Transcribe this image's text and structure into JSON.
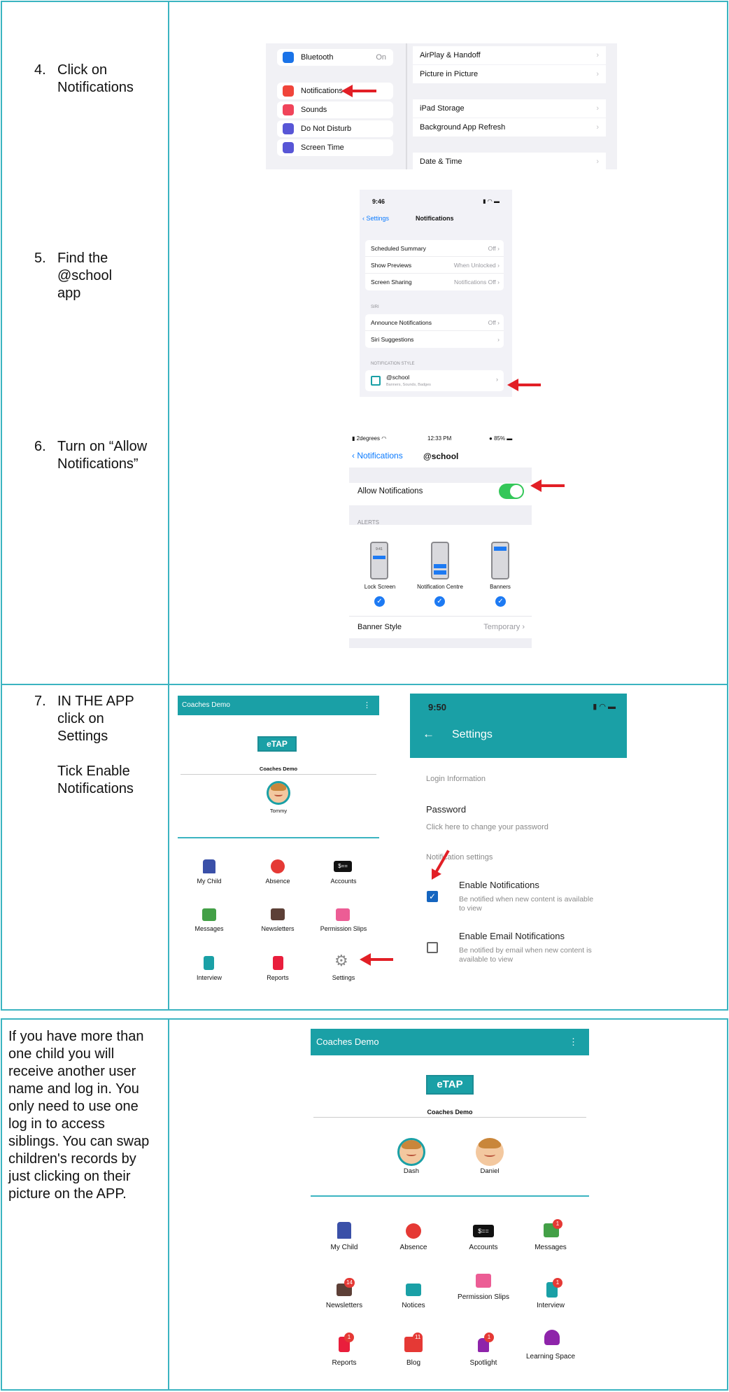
{
  "steps": [
    {
      "number": "4.",
      "lines": [
        "Click on",
        "Notifications"
      ]
    },
    {
      "number": "5.",
      "lines": [
        "Find the",
        "@school app"
      ]
    },
    {
      "number": "6.",
      "lines": [
        "Turn on “Allow",
        "Notifications”"
      ]
    },
    {
      "number": "7.",
      "lines": [
        "IN THE APP",
        "click on",
        "Settings"
      ],
      "extra_lines": [
        "Tick Enable",
        "Notifications"
      ]
    }
  ],
  "siblings_paragraph": [
    "If you have more than",
    "one child you will",
    "receive another user",
    "name and log in. You",
    "only need to use one",
    "log in to access",
    "siblings. You can swap",
    "children's records by",
    "just clicking on their",
    "picture on the APP."
  ],
  "ipad_settings": {
    "left_items": [
      {
        "label": "Bluetooth",
        "value": "On",
        "icon": "bluetooth-icon",
        "color": "#1a73e8"
      },
      {
        "label": "Notifications",
        "value": "",
        "icon": "notifications-icon",
        "color": "#f0443a"
      },
      {
        "label": "Sounds",
        "value": "",
        "icon": "sounds-icon",
        "color": "#f0445a"
      },
      {
        "label": "Do Not Disturb",
        "value": "",
        "icon": "moon-icon",
        "color": "#5856d6"
      },
      {
        "label": "Screen Time",
        "value": "",
        "icon": "hourglass-icon",
        "color": "#5856d6"
      }
    ],
    "right_items": [
      "AirPlay & Handoff",
      "Picture in Picture",
      "iPad Storage",
      "Background App Refresh",
      "Date & Time"
    ]
  },
  "phone_notifications": {
    "time": "9:46",
    "back": "Settings",
    "title": "Notifications",
    "group1": [
      {
        "label": "Scheduled Summary",
        "value": "Off"
      },
      {
        "label": "Show Previews",
        "value": "When Unlocked"
      },
      {
        "label": "Screen Sharing",
        "value": "Notifications Off"
      }
    ],
    "siri_caption": "SIRI",
    "group2": [
      {
        "label": "Announce Notifications",
        "value": "Off"
      },
      {
        "label": "Siri Suggestions",
        "value": ""
      }
    ],
    "style_caption": "NOTIFICATION STYLE",
    "app_name": "@school",
    "app_sub": "Banners, Sounds, Badges"
  },
  "phone_school": {
    "carrier": "2degrees",
    "time": "12:33 PM",
    "battery": "85%",
    "back": "Notifications",
    "title": "@school",
    "allow_label": "Allow Notifications",
    "allow_on": true,
    "alerts_caption": "ALERTS",
    "alert_types": [
      "Lock Screen",
      "Notification Centre",
      "Banners"
    ],
    "lock_time": "9:41",
    "banner_style_label": "Banner Style",
    "banner_style_value": "Temporary"
  },
  "app_home_1": {
    "bar_title": "Coaches Demo",
    "menu_glyph": "⋮",
    "logo": "eTAP",
    "school": "Coaches Demo",
    "child": "Tommy",
    "tiles": [
      "My Child",
      "Absence",
      "Accounts",
      "Messages",
      "Newsletters",
      "Permission Slips",
      "Interview",
      "Reports",
      "Settings"
    ]
  },
  "app_settings": {
    "time": "9:50",
    "title": "Settings",
    "login_section": "Login Information",
    "password_label": "Password",
    "password_hint": "Click here to change your password",
    "notif_section": "Notification settings",
    "enable_label": "Enable Notifications",
    "enable_desc": [
      "Be notified when new content is available",
      "to view"
    ],
    "enable_checked": true,
    "email_label": "Enable Email Notifications",
    "email_desc": [
      "Be notified by email when new content is",
      "available to view"
    ],
    "email_checked": false
  },
  "app_home_2": {
    "bar_title": "Coaches Demo",
    "menu_glyph": "⋮",
    "logo": "eTAP",
    "school": "Coaches Demo",
    "children": [
      "Dash",
      "Daniel"
    ],
    "tiles": [
      {
        "label": "My Child",
        "badge": ""
      },
      {
        "label": "Absence",
        "badge": ""
      },
      {
        "label": "Accounts",
        "badge": ""
      },
      {
        "label": "Messages",
        "badge": "1"
      },
      {
        "label": "Newsletters",
        "badge": "14"
      },
      {
        "label": "Notices",
        "badge": ""
      },
      {
        "label": "Permission Slips",
        "badge": ""
      },
      {
        "label": "Interview",
        "badge": "1"
      },
      {
        "label": "Reports",
        "badge": "1"
      },
      {
        "label": "Blog",
        "badge": "11"
      },
      {
        "label": "Spotlight",
        "badge": "1"
      },
      {
        "label": "Learning Space",
        "badge": ""
      }
    ]
  },
  "colors": {
    "border": "#3bb4c1",
    "teal": "#1aa0a6",
    "arrow": "#e21f26",
    "ios_blue": "#0a7aff",
    "ios_green": "#34c759"
  }
}
